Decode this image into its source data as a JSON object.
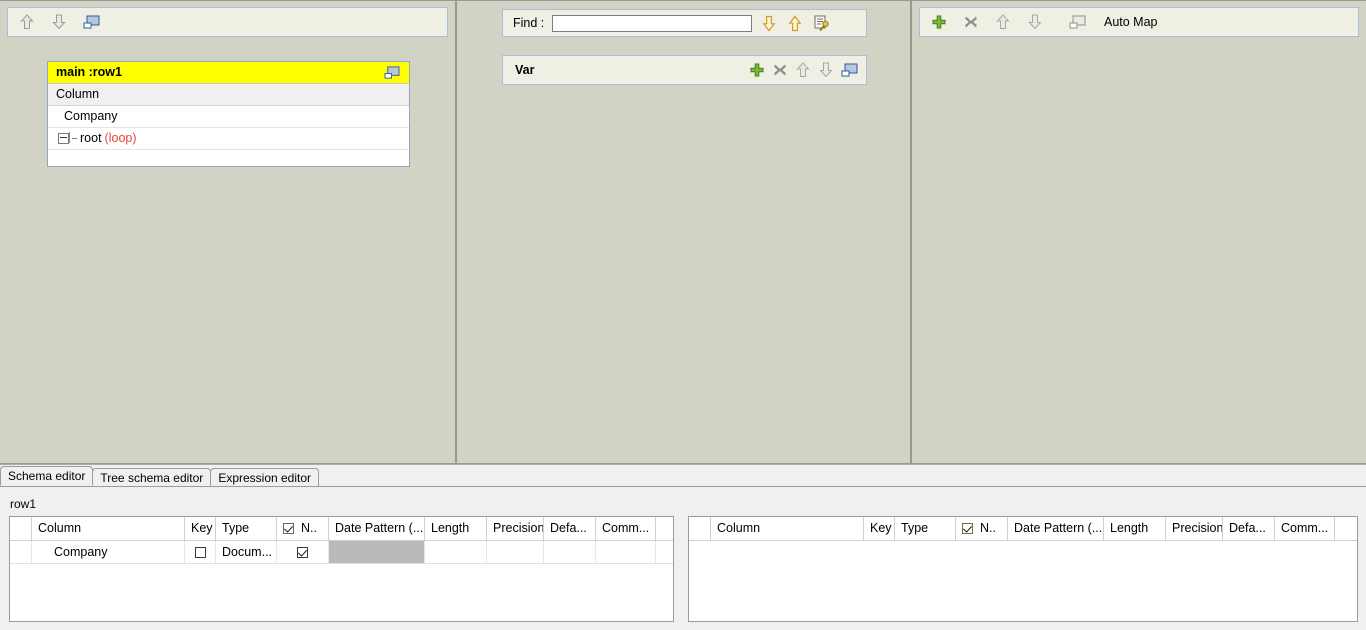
{
  "input_panel": {
    "toolbar": {
      "icons": [
        {
          "name": "move-up-icon",
          "glyph": "arrow-up-outline"
        },
        {
          "name": "move-down-icon",
          "glyph": "arrow-down-outline"
        },
        {
          "name": "minimize-table-icon",
          "glyph": "window-blue"
        }
      ]
    },
    "table": {
      "title": "main :row1",
      "title_icon": "minimize-table-icon",
      "column_header": "Column",
      "rows": [
        {
          "label": "Company",
          "type": "leaf"
        },
        {
          "label": "root",
          "tag": "(loop)",
          "type": "tree-node",
          "expanded": true
        }
      ]
    }
  },
  "var_panel": {
    "find": {
      "label": "Find :",
      "value": "",
      "placeholder": "",
      "icons": [
        {
          "name": "find-next-icon",
          "glyph": "arrow-down-orange"
        },
        {
          "name": "find-previous-icon",
          "glyph": "arrow-up-orange"
        },
        {
          "name": "find-options-icon",
          "glyph": "doc-key"
        }
      ]
    },
    "var_bar": {
      "title": "Var",
      "icons": [
        {
          "name": "add-variable-icon",
          "glyph": "plus-green"
        },
        {
          "name": "remove-variable-icon",
          "glyph": "cross-gray"
        },
        {
          "name": "move-up-icon",
          "glyph": "arrow-up-outline"
        },
        {
          "name": "move-down-icon",
          "glyph": "arrow-down-outline"
        },
        {
          "name": "minimize-table-icon",
          "glyph": "window-blue"
        }
      ]
    }
  },
  "output_panel": {
    "toolbar": {
      "icons": [
        {
          "name": "add-output-icon",
          "glyph": "plus-green"
        },
        {
          "name": "remove-output-icon",
          "glyph": "cross-gray"
        },
        {
          "name": "move-up-icon",
          "glyph": "arrow-up-outline"
        },
        {
          "name": "move-down-icon",
          "glyph": "arrow-down-outline"
        },
        {
          "name": "minimize-table-icon",
          "glyph": "window-gray"
        }
      ],
      "auto_map_label": "Auto Map"
    }
  },
  "bottom": {
    "tabs": [
      {
        "label": "Schema editor",
        "active": true
      },
      {
        "label": "Tree schema editor",
        "active": false
      },
      {
        "label": "Expression editor",
        "active": false
      }
    ],
    "row_label": "row1",
    "grid_left": {
      "headers": {
        "handle": "",
        "column": "Column",
        "key": "Key",
        "type": "Type",
        "nullable_check": "checked",
        "nullable": "N..",
        "date_pattern": "Date Pattern (...",
        "length": "Length",
        "precision": "Precision",
        "default": "Defa...",
        "comment": "Comm..."
      },
      "rows": [
        {
          "column": "Company",
          "key": false,
          "type": "Docum...",
          "nullable": true,
          "date_pattern": "",
          "length": "",
          "precision": "",
          "default": "",
          "comment": ""
        }
      ]
    },
    "grid_right": {
      "headers": {
        "handle": "",
        "column": "Column",
        "key": "Key",
        "type": "Type",
        "nullable_check": "checked",
        "nullable": "N..",
        "date_pattern": "Date Pattern (...",
        "length": "Length",
        "precision": "Precision",
        "default": "Defa...",
        "comment": "Comm..."
      },
      "rows": []
    }
  },
  "colors": {
    "panel_background": "#d1d3c4",
    "toolbar_background": "#f0efe3",
    "table_title_highlight": "#ffff00",
    "loop_tag": "#e8443a",
    "bottom_background": "#f0f0f0"
  }
}
